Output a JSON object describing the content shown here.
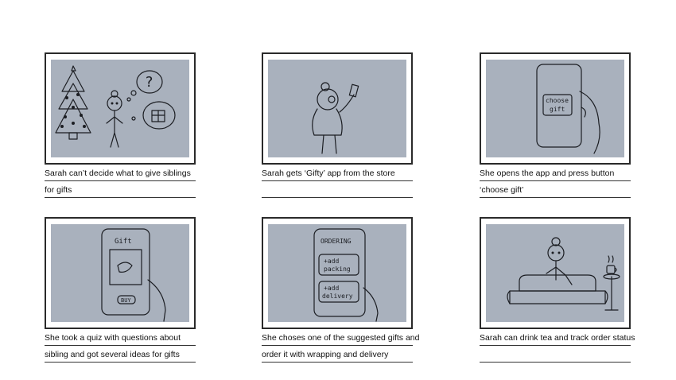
{
  "panels": [
    {
      "lines": [
        "Sarah can’t decide what to give siblings",
        "for gifts"
      ],
      "scene": "sarah-thinking-christmas-tree"
    },
    {
      "lines": [
        "Sarah gets ‘Gifty’ app from the store",
        ""
      ],
      "scene": "sarah-with-phone"
    },
    {
      "lines": [
        "She opens the app and press button",
        " ‘choose gift’"
      ],
      "scene": "hand-holding-phone-choose-gift",
      "sketch_text": [
        "choose",
        "gift"
      ]
    },
    {
      "lines": [
        "She took a quiz with questions about",
        "sibling and got several ideas for gifts"
      ],
      "scene": "phone-gift-suggestion",
      "sketch_text": [
        "Gift",
        "BUY"
      ]
    },
    {
      "lines": [
        "She choses one of the suggested gifts and",
        "order it with wrapping and delivery"
      ],
      "scene": "phone-ordering-screen",
      "sketch_text": [
        "ORDERING",
        "+add",
        "packing",
        "+add",
        "delivery"
      ]
    },
    {
      "lines": [
        "Sarah can drink tea and track order status",
        ""
      ],
      "scene": "sarah-on-sofa-with-tea"
    }
  ],
  "colors": {
    "sketch_bg": "#a9b1bd",
    "frame": "#2a2a2a",
    "ink": "#1b1d22"
  }
}
